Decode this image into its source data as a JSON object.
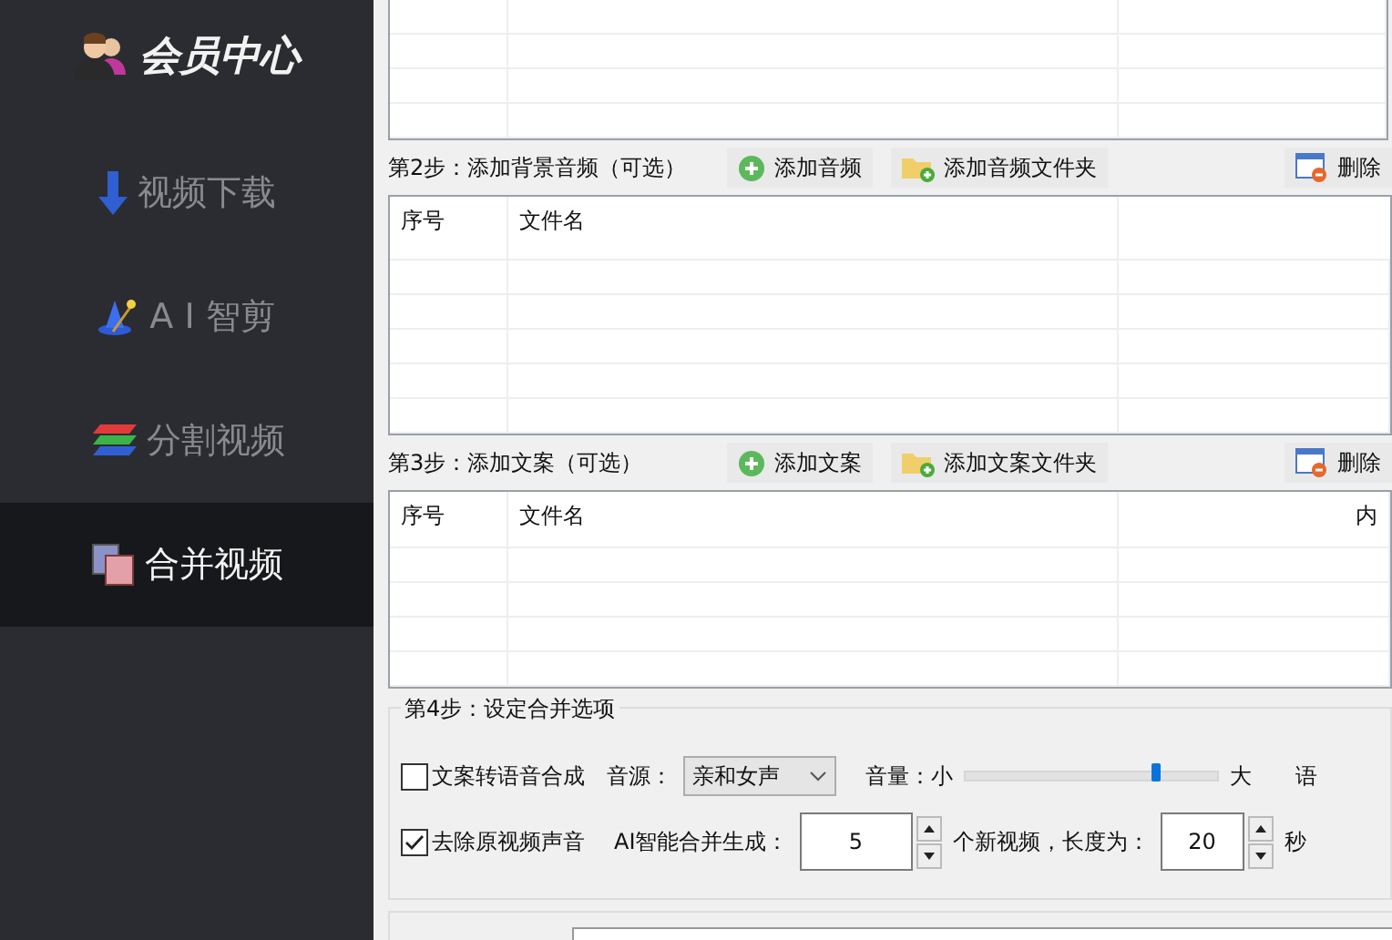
{
  "sidebar": {
    "title": "会员中心",
    "items": [
      {
        "kind": "download",
        "label": "视频下载",
        "selected": false
      },
      {
        "kind": "ai",
        "label": "A I 智剪",
        "selected": false
      },
      {
        "kind": "split",
        "label": "分割视频",
        "selected": false
      },
      {
        "kind": "merge",
        "label": "合并视频",
        "selected": true
      }
    ]
  },
  "steps": [
    {
      "title": "第2步：添加背景音频（可选）",
      "add_button": "添加音频",
      "add_folder_button": "添加音频文件夹",
      "delete_button": "删除",
      "columns": [
        "序号",
        "文件名"
      ]
    },
    {
      "title": "第3步：添加文案（可选）",
      "add_button": "添加文案",
      "add_folder_button": "添加文案文件夹",
      "delete_button": "删除",
      "columns": [
        "序号",
        "文件名",
        "内"
      ]
    }
  ],
  "options": {
    "title": "第4步：设定合并选项",
    "tts": {
      "label": "文案转语音合成",
      "checked": false
    },
    "voice_label": "音源：",
    "voice": "亲和女声",
    "volume_label": "音量：小",
    "volume": {
      "level": 0.75
    },
    "volume_max": "大",
    "speed_label": "语",
    "mute": {
      "label": "去除原视频声音",
      "checked": true
    },
    "count_label": "AI智能合并生成：",
    "count": "5",
    "count_suffix": "个新视频，长度为：",
    "length": "20",
    "length_unit": "秒"
  }
}
